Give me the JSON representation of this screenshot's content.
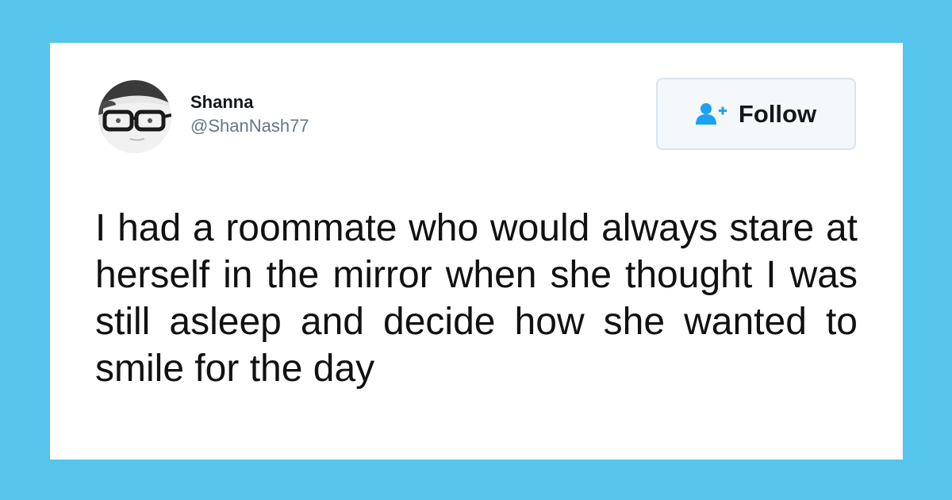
{
  "tweet": {
    "author": {
      "display_name": "Shanna",
      "handle": "@ShanNash77",
      "avatar_icon": "profile-photo"
    },
    "follow_button": {
      "label": "Follow",
      "icon": "add-user-icon",
      "icon_color": "#1da1f2"
    },
    "text": "I had a roommate who would always stare at herself in the mirror when she thought I was still asleep and decide how she wanted to smile for the day"
  },
  "colors": {
    "background": "#55c5eb",
    "card": "#ffffff",
    "handle": "#657786",
    "text": "#111111"
  }
}
